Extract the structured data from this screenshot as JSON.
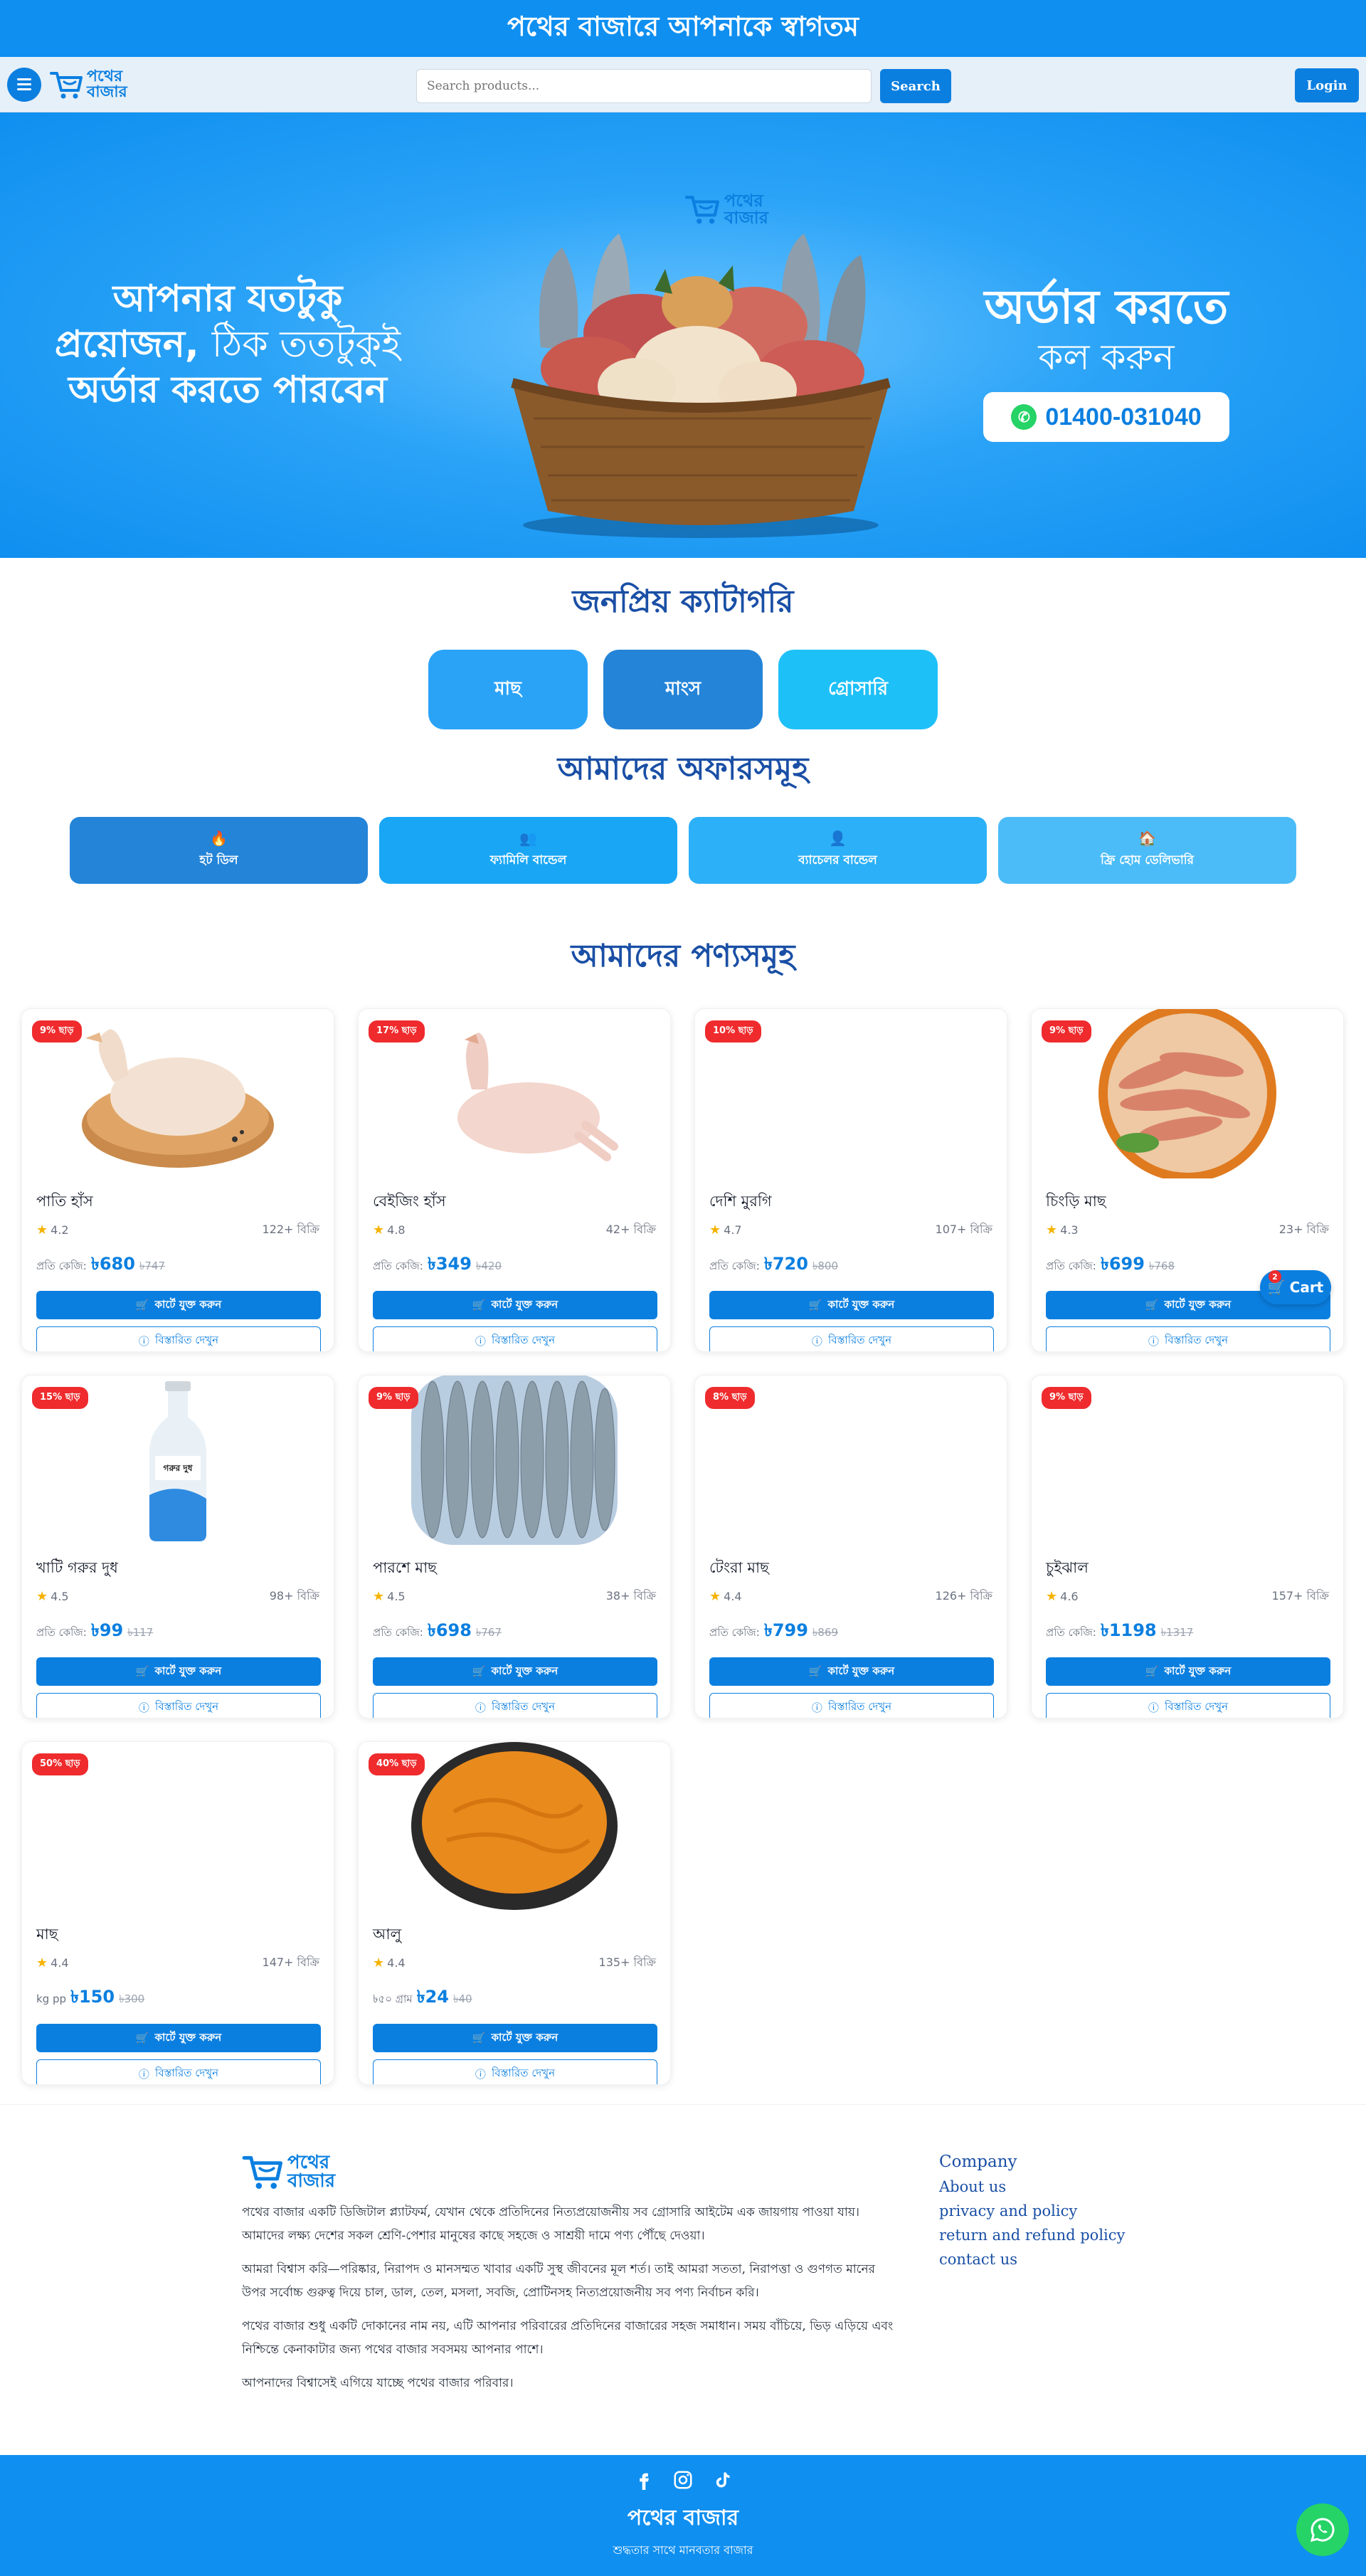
{
  "welcome": {
    "text": "পথের বাজারে আপনাকে স্বাগতম"
  },
  "navbar": {
    "logo_line1": "পথের",
    "logo_line2": "বাজার",
    "search_placeholder": "Search products...",
    "search_button": "Search",
    "login_button": "Login"
  },
  "hero": {
    "left_line1": "আপনার যতটুকু",
    "left_line2_bold": "প্রয়োজন,",
    "left_line2_rest": "ঠিক ততটুকুই",
    "left_line3": "অর্ডার করতে পারবেন",
    "right_big": "অর্ডার করতে",
    "right_mid": "কল করুন",
    "phone": "01400-031040",
    "logo_line1": "পথের",
    "logo_line2": "বাজার"
  },
  "categories": {
    "title": "জনপ্রিয় ক্যাটাগরি",
    "items": [
      {
        "label": "মাছ",
        "color": "#2aa3f7"
      },
      {
        "label": "মাংস",
        "color": "#2384d8"
      },
      {
        "label": "গ্রোসারি",
        "color": "#1ec0f8"
      }
    ]
  },
  "offers": {
    "title": "আমাদের অফারসমূহ",
    "items": [
      {
        "label": "হট ডিল",
        "icon": "fire-icon",
        "color": "#2384d8"
      },
      {
        "label": "ফ্যামিলি বান্ডেল",
        "icon": "users-icon",
        "color": "#19a6f5"
      },
      {
        "label": "ব্যাচেলর বান্ডেল",
        "icon": "user-icon",
        "color": "#2cb0f7"
      },
      {
        "label": "ফ্রি হোম ডেলিভারি",
        "icon": "home-icon",
        "color": "#4bbcf7"
      }
    ]
  },
  "products": {
    "title": "আমাদের পণ্যসমূহ",
    "add_label": "কার্টে যুক্ত করুন",
    "detail_label": "বিস্তারিত দেখুন",
    "items": [
      {
        "badge": "9% ছাড়",
        "name": "পাতি হাঁস",
        "rating": "4.2",
        "sold": "122+ বিক্রি",
        "unit": "প্রতি কেজি:",
        "price": "৳680",
        "old": "৳747",
        "image": "duck"
      },
      {
        "badge": "17% ছাড়",
        "name": "বেইজিং হাঁস",
        "rating": "4.8",
        "sold": "42+ বিক্রি",
        "unit": "প্রতি কেজি:",
        "price": "৳349",
        "old": "৳420",
        "image": "duck2"
      },
      {
        "badge": "10% ছাড়",
        "name": "দেশি মুরগি",
        "rating": "4.7",
        "sold": "107+ বিক্রি",
        "unit": "প্রতি কেজি:",
        "price": "৳720",
        "old": "৳800",
        "image": "none"
      },
      {
        "badge": "9% ছাড়",
        "name": "চিংড়ি মাছ",
        "rating": "4.3",
        "sold": "23+ বিক্রি",
        "unit": "প্রতি কেজি:",
        "price": "৳699",
        "old": "৳768",
        "image": "shrimp"
      },
      {
        "badge": "15% ছাড়",
        "name": "খাটি গরুর দুধ",
        "rating": "4.5",
        "sold": "98+ বিক্রি",
        "unit": "প্রতি কেজি:",
        "price": "৳99",
        "old": "৳117",
        "image": "milk"
      },
      {
        "badge": "9% ছাড়",
        "name": "পারশে মাছ",
        "rating": "4.5",
        "sold": "38+ বিক্রি",
        "unit": "প্রতি কেজি:",
        "price": "৳698",
        "old": "৳767",
        "image": "fish"
      },
      {
        "badge": "8% ছাড়",
        "name": "টেংরা মাছ",
        "rating": "4.4",
        "sold": "126+ বিক্রি",
        "unit": "প্রতি কেজি:",
        "price": "৳799",
        "old": "৳869",
        "image": "none"
      },
      {
        "badge": "9% ছাড়",
        "name": "চুইঝাল",
        "rating": "4.6",
        "sold": "157+ বিক্রি",
        "unit": "প্রতি কেজি:",
        "price": "৳1198",
        "old": "৳1317",
        "image": "none"
      },
      {
        "badge": "50% ছাড়",
        "name": "মাছ",
        "rating": "4.4",
        "sold": "147+ বিক্রি",
        "unit": "kg pp",
        "price": "৳150",
        "old": "৳300",
        "image": "none"
      },
      {
        "badge": "40% ছাড়",
        "name": "আলু",
        "rating": "4.4",
        "sold": "135+ বিক্রি",
        "unit": "৳৫০ গ্রাম",
        "price": "৳24",
        "old": "৳40",
        "image": "paste"
      }
    ]
  },
  "float_cart": {
    "label": "Cart",
    "count": "2"
  },
  "footer": {
    "logo_line1": "পথের",
    "logo_line2": "বাজার",
    "para1": "পথের বাজার একটি ডিজিটাল প্ল্যাটফর্ম, যেখান থেকে প্রতিদিনের নিত্যপ্রয়োজনীয় সব গ্রোসারি আইটেম এক জায়গায় পাওয়া যায়। আমাদের লক্ষ্য দেশের সকল শ্রেণি-পেশার মানুষের কাছে সহজে ও সাশ্রয়ী দামে পণ্য পৌঁছে দেওয়া।",
    "para2": "আমরা বিশ্বাস করি—পরিষ্কার, নিরাপদ ও মানসম্মত খাবার একটি সুস্থ জীবনের মূল শর্ত। তাই আমরা সততা, নিরাপত্তা ও গুণগত মানের উপর সর্বোচ্চ গুরুত্ব দিয়ে চাল, ডাল, তেল, মসলা, সবজি, প্রোটিনসহ নিত্যপ্রয়োজনীয় সব পণ্য নির্বাচন করি।",
    "para3": "পথের বাজার শুধু একটি দোকানের নাম নয়, এটি আপনার পরিবারের প্রতিদিনের বাজারের সহজ সমাধান। সময় বাঁচিয়ে, ভিড় এড়িয়ে এবং নিশ্চিন্তে কেনাকাটার জন্য পথের বাজার সবসময় আপনার পাশে।",
    "para4": "আপনাদের বিশ্বাসেই এগিয়ে যাচ্ছে পথের বাজার পরিবার।",
    "company_title": "Company",
    "links": [
      "About us",
      "privacy and policy",
      "return and refund policy",
      "contact us"
    ],
    "brand": "পথের বাজার",
    "tagline": "শুদ্ধতার সাথে মানবতার বাজার"
  }
}
